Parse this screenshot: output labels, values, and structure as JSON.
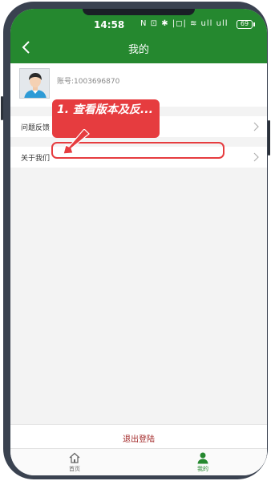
{
  "status_bar": {
    "time": "14:58",
    "icons_text": "N ⊡ ✱ |◻| ≋ ull ull",
    "battery": "69"
  },
  "header": {
    "title": "我的"
  },
  "profile": {
    "account_label": "账号:1003696870"
  },
  "menu": [
    {
      "label": "问题反馈"
    },
    {
      "label": "关于我们"
    }
  ],
  "annotation": {
    "callout_text": "1. 查看版本及反..."
  },
  "logout_label": "退出登陆",
  "tabs": [
    {
      "label": "首页"
    },
    {
      "label": "我的"
    }
  ],
  "colors": {
    "primary": "#25882f",
    "annotation_red": "#e63c3f",
    "logout_red": "#a22727"
  }
}
